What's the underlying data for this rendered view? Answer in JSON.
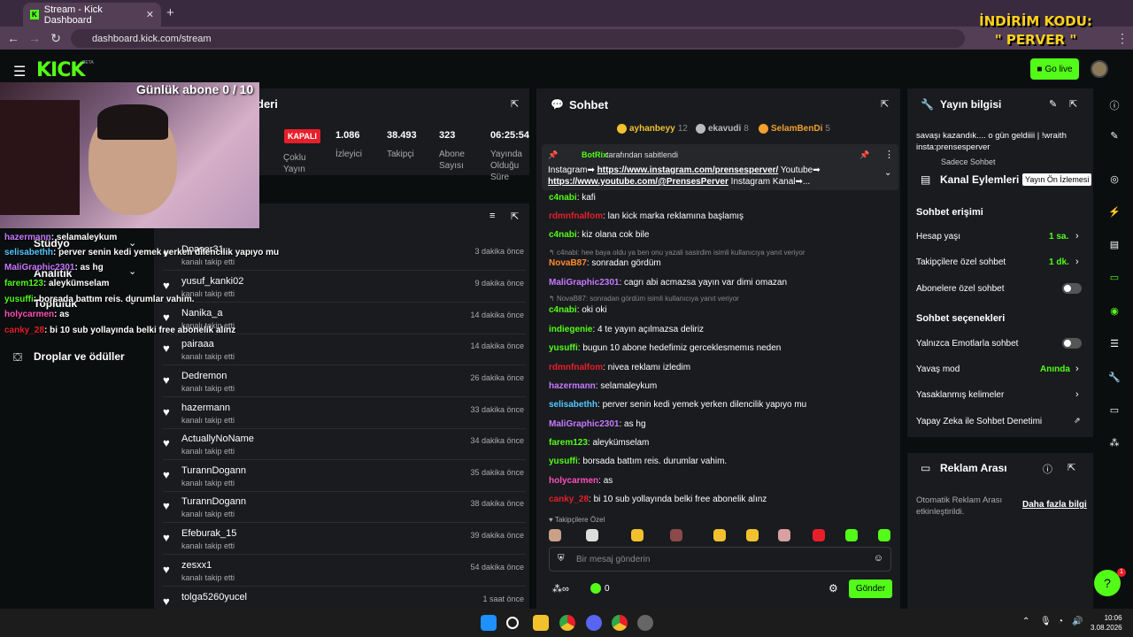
{
  "browser": {
    "tab_title": "Stream - Kick Dashboard",
    "url": "dashboard.kick.com/stream"
  },
  "promo": {
    "line1": "İNDİRİM KODU:",
    "line2": "\" PERVER \""
  },
  "topnav": {
    "logo": "KICK",
    "beta": "BETA",
    "go_live": "Go live"
  },
  "overlay": {
    "subgoal": "Günlük abone 0 / 10",
    "chat": [
      {
        "user": "hazermann",
        "text": ": selamaleykum",
        "color": "#c879ff"
      },
      {
        "user": "selisabethh",
        "text": ": perver senin kedi yemek yerken dilencilik yapıyo mu",
        "color": "#53c8ff"
      },
      {
        "user": "MaliGraphic2301",
        "text": ": as hg",
        "color": "#c879ff"
      },
      {
        "user": "farem123",
        "text": ": aleykümselam",
        "color": "#53fc18"
      },
      {
        "user": "yusuffi",
        "text": ": borsada battım reis. durumlar vahim.",
        "color": "#53fc18"
      },
      {
        "user": "holycarmen",
        "text": ": as",
        "color": "#ff4fb8"
      },
      {
        "user": "canky_28",
        "text": ": bi 10 sub yollayında belki free abonelik alınz",
        "color": "#e81f2a"
      }
    ]
  },
  "sidebar": {
    "studio": "Stüdyo",
    "analytics": "Analitik",
    "community": "Topluluk",
    "drops": "Droplar ve ödüller"
  },
  "stream_panel": {
    "title": "deri",
    "status": "KAPALI",
    "multi": "Çoklu Yayın",
    "stats": [
      {
        "value": "1.086",
        "label": "İzleyici"
      },
      {
        "value": "38.493",
        "label": "Takipçi"
      },
      {
        "value": "323",
        "label": "Abone Sayısı"
      },
      {
        "value": "06:25:54",
        "label": "Yayında Olduğu Süre"
      }
    ]
  },
  "follows": [
    {
      "name": "Dpaser31",
      "sub": "kanalı takip etti",
      "time": "3 dakika önce"
    },
    {
      "name": "yusuf_kanki02",
      "sub": "kanalı takip etti",
      "time": "9 dakika önce"
    },
    {
      "name": "Nanika_a",
      "sub": "kanalı takip etti",
      "time": "14 dakika önce"
    },
    {
      "name": "pairaaa",
      "sub": "kanalı takip etti",
      "time": "14 dakika önce"
    },
    {
      "name": "Dedremon",
      "sub": "kanalı takip etti",
      "time": "26 dakika önce"
    },
    {
      "name": "hazermann",
      "sub": "kanalı takip etti",
      "time": "33 dakika önce"
    },
    {
      "name": "ActuallyNoName",
      "sub": "kanalı takip etti",
      "time": "34 dakika önce"
    },
    {
      "name": "TurannDogann",
      "sub": "kanalı takip etti",
      "time": "35 dakika önce"
    },
    {
      "name": "TurannDogann",
      "sub": "kanalı takip etti",
      "time": "38 dakika önce"
    },
    {
      "name": "Efeburak_15",
      "sub": "kanalı takip etti",
      "time": "39 dakika önce"
    },
    {
      "name": "zesxx1",
      "sub": "kanalı takip etti",
      "time": "54 dakika önce"
    },
    {
      "name": "tolga5260yucel",
      "sub": "",
      "time": "1 saat önce"
    }
  ],
  "chat": {
    "title": "Sohbet",
    "top_gifters": [
      {
        "name": "ayhanbeyy",
        "count": "12"
      },
      {
        "name": "ekavudi",
        "count": "8"
      },
      {
        "name": "SelamBenDi",
        "count": "5"
      }
    ],
    "pinned_by": "BotRix",
    "pinned_label": "tarafından sabitlendi",
    "pinned_text1_a": "Instagram➡ ",
    "pinned_link1": "https://www.instagram.com/prensesperver/",
    "pinned_text1_b": " Youtube➡",
    "pinned_link2": "https://www.youtube.com/@PrensesPerver",
    "pinned_text2_b": " Instagram Kanal➡...",
    "messages": [
      {
        "user": "c4nabi",
        "text": ": kafi",
        "color": "#53fc18"
      },
      {
        "user": "rdmnfnalfom",
        "text": ": lan kick marka reklamına başlamış",
        "color": "#e81f2a"
      },
      {
        "user": "c4nabi",
        "text": ": kiz olana cok bile",
        "color": "#53fc18"
      },
      {
        "reply": "c4nabi: hee baya oldu ya ben onu yazali sasirdim isimli kullanıcıya yanıt veriyor"
      },
      {
        "user": "NovaB87",
        "text": ": sonradan gördüm",
        "color": "#ff8c2a"
      },
      {
        "user": "MaliGraphic2301",
        "text": ": cagrı abi acmazsa yayın var dimi omazan",
        "color": "#c879ff"
      },
      {
        "reply": "NovaB87: sonradan gördüm isimli kullanıcıya yanıt veriyor"
      },
      {
        "user": "c4nabi",
        "text": ": oki oki",
        "color": "#53fc18"
      },
      {
        "user": "indiegenie",
        "text": ": 4 te yayın açılmazsa deliriz",
        "color": "#53fc18"
      },
      {
        "user": "yusuffi",
        "text": ": bugun 10 abone hedefimiz gerceklesmemıs neden",
        "color": "#53fc18"
      },
      {
        "user": "rdmnfnalfom",
        "text": ": nivea reklamı izledim",
        "color": "#e81f2a"
      },
      {
        "user": "hazermann",
        "text": ": selamaleykum",
        "color": "#c879ff"
      },
      {
        "user": "selisabethh",
        "text": ": perver senin kedi yemek yerken dilencilik yapıyo mu",
        "color": "#53c8ff"
      },
      {
        "user": "MaliGraphic2301",
        "text": ": as hg",
        "color": "#c879ff"
      },
      {
        "user": "farem123",
        "text": ": aleykümselam",
        "color": "#53fc18"
      },
      {
        "user": "yusuffi",
        "text": ": borsada battım reis. durumlar vahim.",
        "color": "#53fc18"
      },
      {
        "user": "holycarmen",
        "text": ": as",
        "color": "#ff4fb8"
      },
      {
        "user": "canky_28",
        "text": ": bi 10 sub yollayında belki free abonelik alınz",
        "color": "#e81f2a"
      }
    ],
    "followers_only": "Takipçilere Özel",
    "input_placeholder": "Bir mesaj gönderin",
    "count": "0",
    "send": "Gönder"
  },
  "stream_info": {
    "title": "Yayın bilgisi",
    "text": "savaşı kazandık.... o gün geldiiii | !wraith insta:prensesperver",
    "category": "Sadece Sohbet"
  },
  "channel_actions": {
    "title": "Kanal Eylemleri",
    "tooltip": "Yayın Ön İzlemesi",
    "access_title": "Sohbet erişimi",
    "rows1": [
      {
        "label": "Hesap yaşı",
        "value": "1 sa."
      },
      {
        "label": "Takipçilere özel sohbet",
        "value": "1 dk."
      },
      {
        "label": "Abonelere özel sohbet",
        "value": ""
      }
    ],
    "options_title": "Sohbet seçenekleri",
    "rows2": [
      {
        "label": "Yalnızca Emotlarla sohbet",
        "value": ""
      },
      {
        "label": "Yavaş mod",
        "value": "Anında"
      },
      {
        "label": "Yasaklanmış kelimeler",
        "value": ""
      },
      {
        "label": "Yapay Zeka ile Sohbet Denetimi",
        "value": ""
      }
    ]
  },
  "ad_break": {
    "title": "Reklam Arası",
    "text": "Otomatik Reklam Arası etkinleştirildi.",
    "link": "Daha fazla bilgi"
  },
  "taskbar": {
    "time": "10:06",
    "date": "3.08.2026"
  },
  "colors": {
    "accent": "#53fc18",
    "live_red": "#e81f2a",
    "panel": "#191b1f",
    "bg": "#0b0e0f"
  }
}
